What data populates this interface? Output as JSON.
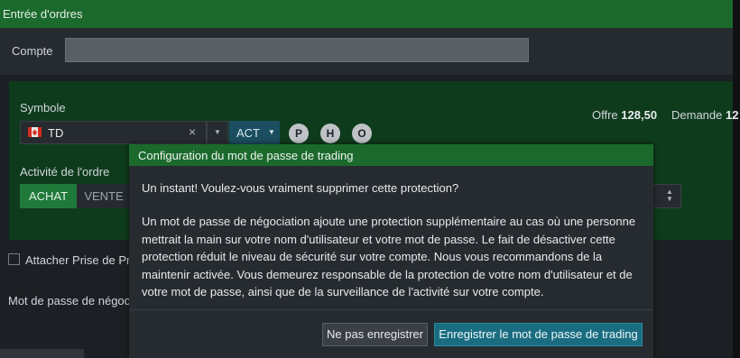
{
  "window": {
    "title": "Entrée d'ordres"
  },
  "account": {
    "label": "Compte",
    "value": ""
  },
  "symbol": {
    "label": "Symbole",
    "value": "TD",
    "flag": "canada-flag",
    "clear_icon": "×",
    "dropdown_icon": "▼",
    "market": "ACT",
    "buttons": [
      "P",
      "H",
      "O"
    ]
  },
  "quote": {
    "ask_label": "Offre",
    "ask_value": "128,50",
    "bid_label": "Demande",
    "bid_value": "12"
  },
  "activity": {
    "label": "Activité de l'ordre",
    "buy": "ACHAT",
    "sell": "VENTE"
  },
  "attach": {
    "label": "Attacher Prise de Pro"
  },
  "password": {
    "label": "Mot de passe de négoci"
  },
  "modal": {
    "title": "Configuration du mot de passe de trading",
    "question": "Un instant! Voulez-vous vraiment supprimer cette protection?",
    "body_lines": [
      "Un mot de passe de négociation ajoute une protection supplémentaire au cas où une personne",
      "mettrait la main sur votre nom d'utilisateur et votre mot de passe. Le fait de désactiver cette",
      "protection réduit le niveau de sécurité sur votre compte. Nous vous recommandons de la",
      "maintenir activée. Vous demeurez responsable de la protection de votre nom d'utilisateur et de",
      "votre mot de passe, ainsi que de la surveillance de l'activité sur votre compte."
    ],
    "dont_save": "Ne pas enregistrer",
    "save": "Enregistrer le mot de passe de trading"
  },
  "colors": {
    "header_green": "#1b6a2c",
    "panel_green": "#0e3b1c",
    "primary_button": "#1a6d80"
  }
}
